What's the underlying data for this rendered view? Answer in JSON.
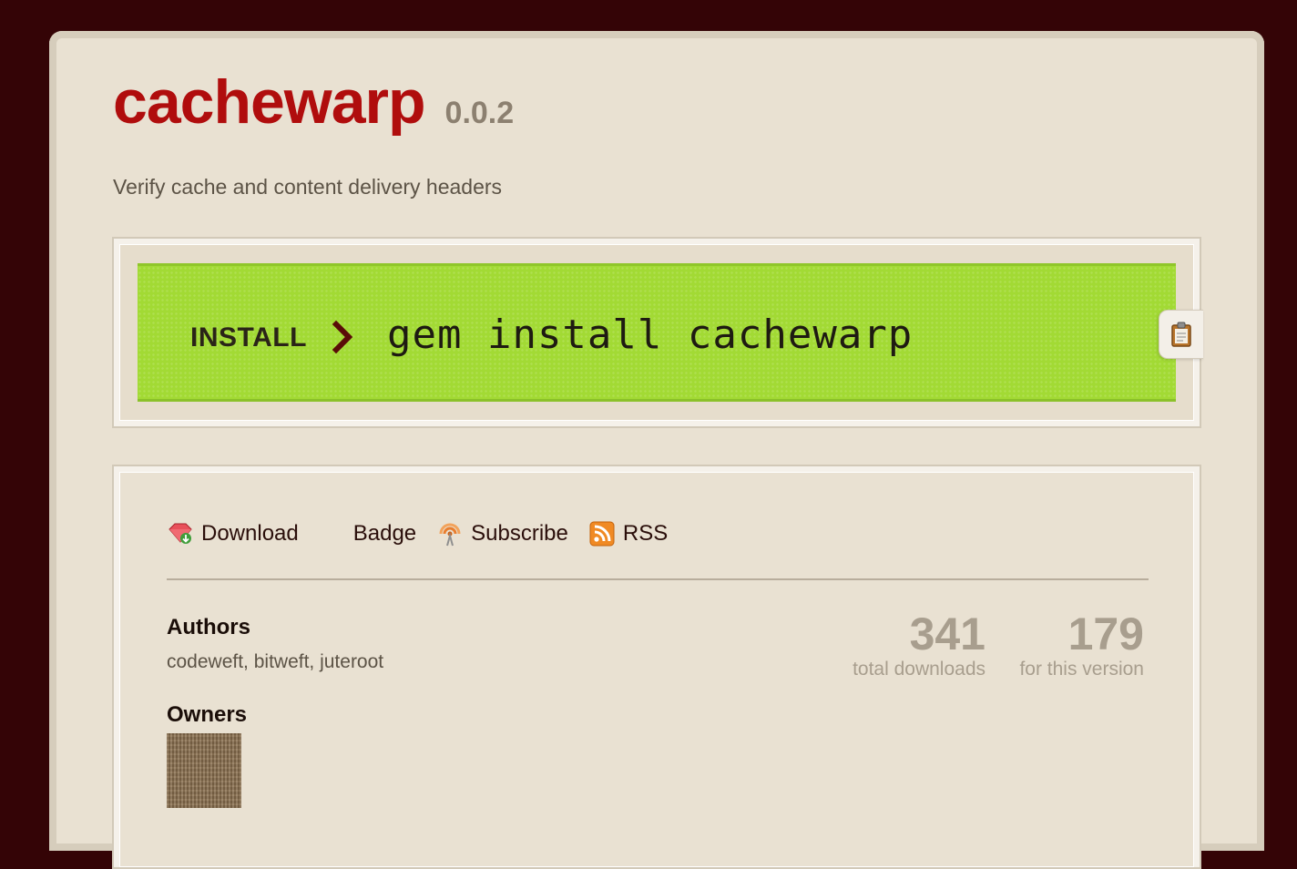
{
  "gem": {
    "name": "cachewarp",
    "version": "0.0.2",
    "description": "Verify cache and content delivery headers"
  },
  "install": {
    "label": "INSTALL",
    "command": "gem install cachewarp"
  },
  "links": {
    "download": "Download",
    "badge": "Badge",
    "subscribe": "Subscribe",
    "rss": "RSS"
  },
  "authors": {
    "title": "Authors",
    "list": "codeweft, bitweft, juteroot"
  },
  "owners": {
    "title": "Owners"
  },
  "stats": {
    "total_downloads": "341",
    "total_downloads_label": "total downloads",
    "version_downloads": "179",
    "version_downloads_label": "for this version"
  },
  "icons": {
    "arrow": "chevron-right-icon",
    "clipboard": "clipboard-icon",
    "download": "gem-download-icon",
    "subscribe": "subscribe-icon",
    "rss": "rss-icon"
  },
  "colors": {
    "background": "#340406",
    "page": "#e9e1d2",
    "gem_name": "#b00d0d",
    "install_bar": "#a2da34"
  }
}
